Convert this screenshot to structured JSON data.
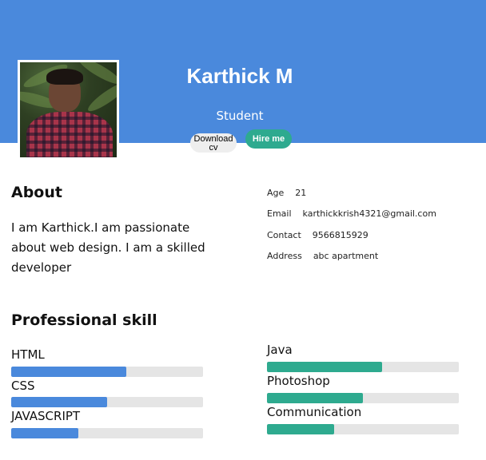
{
  "profile": {
    "name": "Karthick M",
    "role": "Student",
    "photo_icon": "profile-photo"
  },
  "buttons": {
    "download_label": "Download cv",
    "hire_label": "Hire me"
  },
  "about": {
    "title": "About",
    "text": "I am Karthick.I am passionate about web design. I am a skilled developer"
  },
  "info": [
    {
      "label": "Age",
      "value": "21"
    },
    {
      "label": "Email",
      "value": "karthickkrish4321@gmail.com"
    },
    {
      "label": "Contact",
      "value": "9566815929"
    },
    {
      "label": "Address",
      "value": "abc apartment"
    }
  ],
  "skills": {
    "title": "Professional skill",
    "left": [
      {
        "name": "HTML",
        "level": 0.6
      },
      {
        "name": "CSS",
        "level": 0.5
      },
      {
        "name": "JAVASCRIPT",
        "level": 0.35
      }
    ],
    "right": [
      {
        "name": "Java",
        "level": 0.6
      },
      {
        "name": "Photoshop",
        "level": 0.5
      },
      {
        "name": "Communication",
        "level": 0.35
      }
    ]
  },
  "colors": {
    "header": "#4a89dc",
    "accent_green": "#2eaa8f",
    "bar_blue": "#4a89dc",
    "bar_track": "#e5e5e5"
  }
}
